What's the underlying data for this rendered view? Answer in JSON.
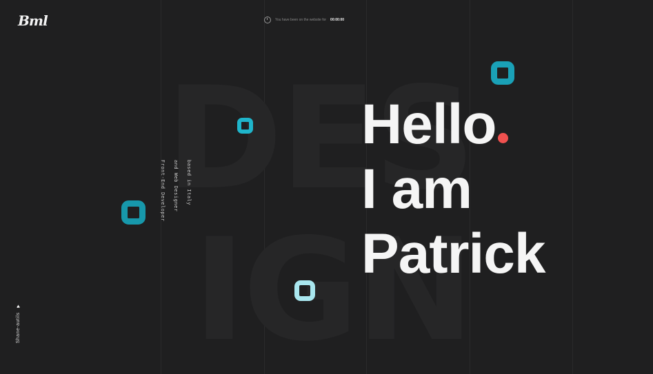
{
  "header": {
    "logo_text": "Bml",
    "notice_text": "You have been on the website for",
    "timer_text": "00:00:00"
  },
  "background": {
    "word_top": "DES",
    "word_bottom": "IGN"
  },
  "intro": {
    "role_lines": [
      "Front-End Developer",
      "and Web Designer",
      "based in Italy"
    ]
  },
  "hero": {
    "line1": "Hello",
    "line2": "I am",
    "line3": "Patrick"
  },
  "side": {
    "link_text": "Shane-autils"
  },
  "colors": {
    "accent_teal": "#1aa1b7",
    "accent_light": "#a9e7ef",
    "accent_red": "#f0514f",
    "background": "#1f1f20"
  },
  "icons": {
    "clock": "clock-icon",
    "heart": "heart-icon"
  }
}
